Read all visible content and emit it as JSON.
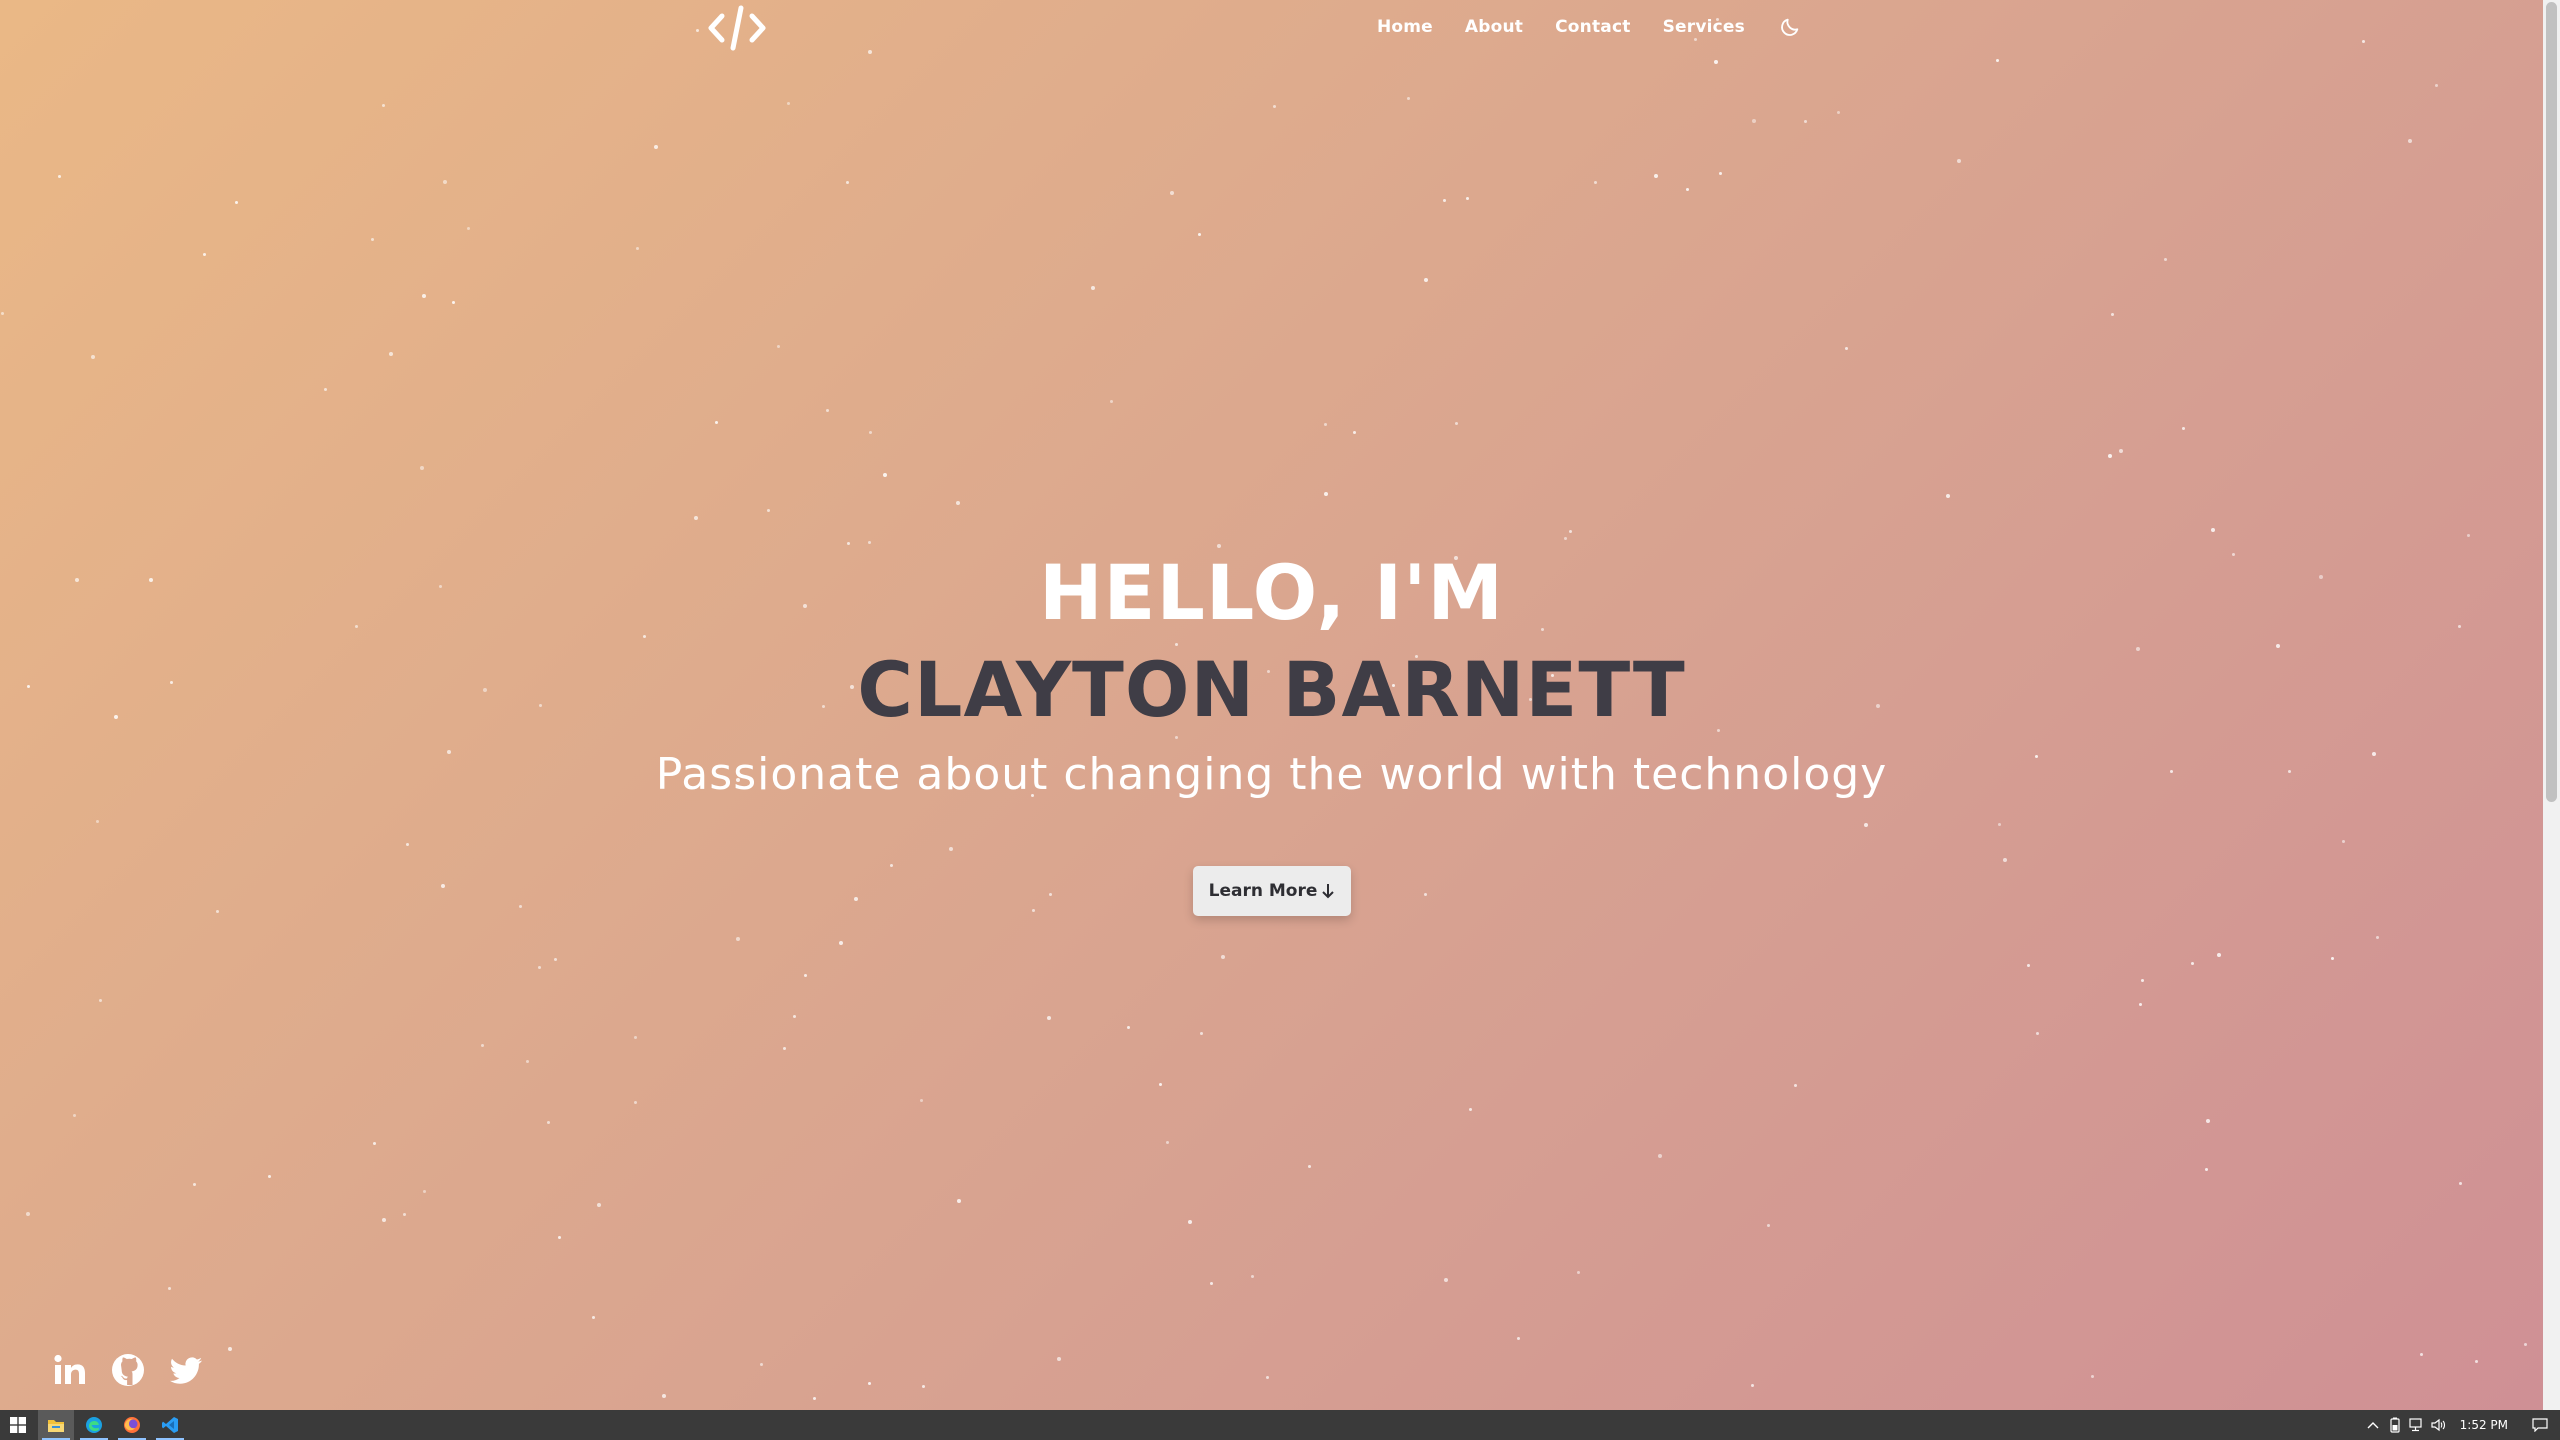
{
  "nav": {
    "items": [
      {
        "label": "Home"
      },
      {
        "label": "About"
      },
      {
        "label": "Contact"
      },
      {
        "label": "Services"
      }
    ]
  },
  "hero": {
    "greeting": "HELLO, I'M",
    "name": "CLAYTON BARNETT",
    "tagline": "Passionate about changing the world with technology",
    "button_label": "Learn More",
    "button_icon": "arrow-down-icon"
  },
  "social": [
    "linkedin-icon",
    "github-icon",
    "twitter-icon"
  ],
  "taskbar": {
    "apps": [
      "start-icon",
      "file-explorer-icon",
      "edge-icon",
      "firefox-icon",
      "vscode-icon"
    ],
    "clock": "1:52 PM"
  },
  "colors": {
    "gradient_start": "#eab886",
    "gradient_end": "#cf9095",
    "name_color": "#3f3d46",
    "button_bg": "#ececec",
    "taskbar_bg": "#3a3a3a"
  }
}
